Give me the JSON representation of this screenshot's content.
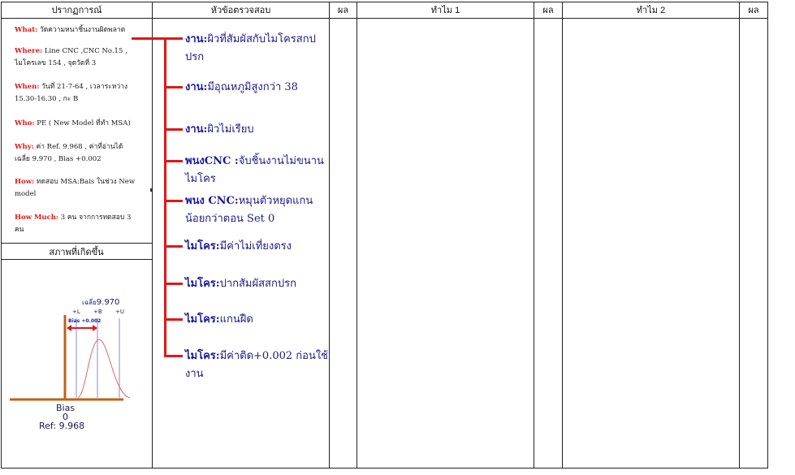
{
  "headers": {
    "phenomenon": "ปรากฏการณ์",
    "topic": "หัวข้อตรวจสอบ",
    "result1": "ผล",
    "why1": "ทำไม 1",
    "result2": "ผล",
    "why2": "ทำไม 2",
    "result3": "ผล"
  },
  "phenomenon": {
    "what_key": "What:",
    "what_val": " วัดความหนาชิ้นงานผิดพลาด",
    "where_key": "Where:",
    "where_val": " Line CNC ,CNC No.15 , ไมโครเลข 154 , จุดวัดที่ 3",
    "when_key": "When:",
    "when_val": " วันที่ 21-7-64 , เวลาระหว่าง 15.30-16.30 , กะ B",
    "who_key": "Who:",
    "who_val": " PE ( New Model ที่ทำ MSA)",
    "why_key": "Why:",
    "why_val": " ค่า Ref. 9.968 , ค่าที่อ่านได้เฉลี่ย 9.970 , Bias +0.002",
    "how_key": "How:",
    "how_val": " ทดสอบ MSA:Bais ในช่วง New model",
    "howmuch_key": "How Much:",
    "howmuch_val": " 3 คน จากการทดสอบ 3 คน"
  },
  "condition_title": "สภาพที่เกิดขึ้น",
  "chart": {
    "avg_label": "เฉลี่ย",
    "avg_value": "9.970",
    "minus_l": "+L",
    "plus_b": "+B",
    "plus_u": "+U",
    "bias_tag": "Bias +0.002",
    "bias_label": "Bias",
    "bias_zero": "0",
    "ref_label": "Ref: 9.968"
  },
  "branches": [
    {
      "key": "งาน:",
      "text": "ผิวที่สัมผัสกับไมโครสกปปรก"
    },
    {
      "key": "งาน:",
      "text": "มีอุณหภูมิสูงกว่า 38"
    },
    {
      "key": "งาน:",
      "text": "ผิวไม่เรียบ"
    },
    {
      "key": "พนงCNC :",
      "text": "จับชิ้นงานไม่ขนานไมโคร"
    },
    {
      "key": "พนง CNC:",
      "text": "หมุนตัวหยุดแกนน้อยกว่าตอน Set 0"
    },
    {
      "key": "ไมโคร:",
      "text": "มีค่าไม่เที่ยงตรง"
    },
    {
      "key": "ไมโคร:",
      "text": "ปากสัมผัสสกปรก"
    },
    {
      "key": "ไมโคร:",
      "text": "แกนฝืด"
    },
    {
      "key": "ไมโคร:",
      "text": "มีค่าติด+0.002 ก่อนใช้งาน"
    }
  ],
  "colors": {
    "key_red": "#e01818",
    "branch_blue": "#1a1aa0",
    "chart_brown": "#c0601a"
  }
}
